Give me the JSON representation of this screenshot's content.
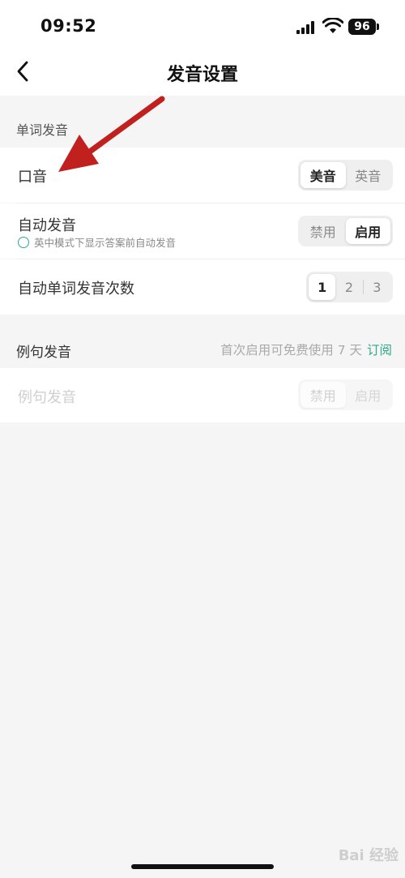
{
  "status_bar": {
    "time": "09:52",
    "battery": "96"
  },
  "nav": {
    "title": "发音设置",
    "back_icon": "chevron-left-icon"
  },
  "word_section": {
    "label": "单词发音",
    "accent": {
      "label": "口音",
      "options": [
        "美音",
        "英音"
      ],
      "selected": "美音"
    },
    "auto": {
      "label": "自动发音",
      "hint": "英中模式下显示答案前自动发音",
      "options": [
        "禁用",
        "启用"
      ],
      "selected": "启用"
    },
    "count": {
      "label": "自动单词发音次数",
      "options": [
        "1",
        "2",
        "3"
      ],
      "selected": "1"
    }
  },
  "sentence_section": {
    "label": "例句发音",
    "trial_text": "首次启用可免费使用 7 天",
    "subscribe": "订阅",
    "row": {
      "label": "例句发音",
      "options": [
        "禁用",
        "启用"
      ],
      "selected": "禁用"
    }
  },
  "watermark": "Bai 经验",
  "colors": {
    "accent": "#2fa98a",
    "annotation_arrow": "#c0201e"
  }
}
